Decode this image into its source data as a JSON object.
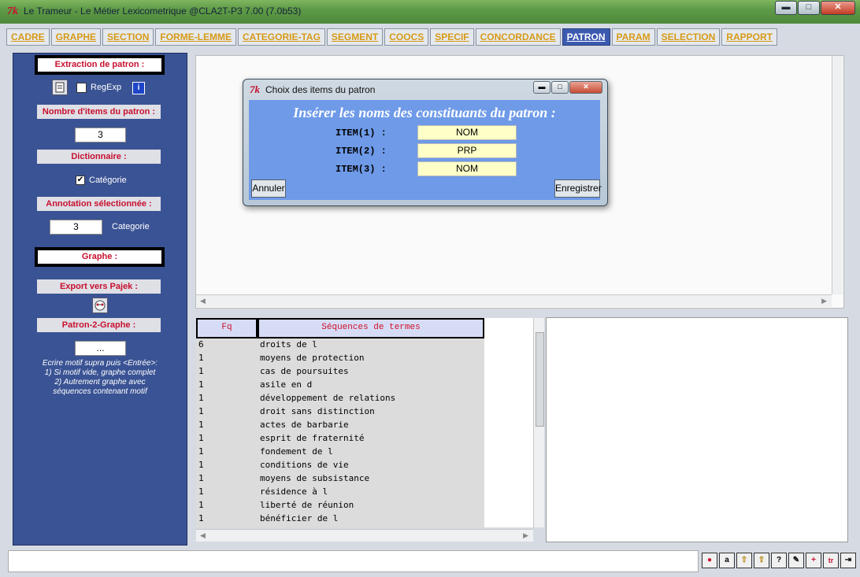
{
  "window": {
    "title": "Le Trameur - Le Métier Lexicometrique @CLA2T-P3 7.00 (7.0b53)",
    "tk_logo": "7k",
    "min": "▬",
    "max": "□",
    "close": "✕"
  },
  "tabs": [
    {
      "label": "CADRE"
    },
    {
      "label": "GRAPHE"
    },
    {
      "label": "SECTION"
    },
    {
      "label": "FORME-LEMME"
    },
    {
      "label": "CATEGORIE-TAG"
    },
    {
      "label": "SEGMENT"
    },
    {
      "label": "COOCS"
    },
    {
      "label": "SPECIF"
    },
    {
      "label": "CONCORDANCE"
    },
    {
      "label": "PATRON",
      "active": true
    },
    {
      "label": "PARAM"
    },
    {
      "label": "SELECTION"
    },
    {
      "label": "RAPPORT"
    }
  ],
  "left": {
    "extraction_label": "Extraction de patron :",
    "regexp_label": "RegExp",
    "regexp_checked": false,
    "info_icon": "i",
    "nb_items_label": "Nombre d'items du patron :",
    "nb_items_value": "3",
    "dictionnaire_label": "Dictionnaire :",
    "categorie_check_label": "Catégorie",
    "categorie_checked": true,
    "annotation_label": "Annotation sélectionnée :",
    "annotation_value": "3",
    "annotation_type": "Categorie",
    "graphe_label": "Graphe :",
    "pajek_label": "Export vers Pajek :",
    "patron2graphe_label": "Patron-2-Graphe :",
    "patron2graphe_value": "...",
    "note_lines": [
      "Ecrire motif supra puis <Entrée>:",
      "1) Si motif vide, graphe complet",
      "2)  Autrement graphe avec",
      "séquences contenant motif"
    ]
  },
  "table": {
    "col_fq": "Fq",
    "col_seq": "Séquences de termes",
    "rows": [
      {
        "fq": "6",
        "seq": "droits de l"
      },
      {
        "fq": "1",
        "seq": "moyens de protection"
      },
      {
        "fq": "1",
        "seq": "cas de poursuites"
      },
      {
        "fq": "1",
        "seq": "asile en d"
      },
      {
        "fq": "1",
        "seq": "développement de relations"
      },
      {
        "fq": "1",
        "seq": "droit sans distinction"
      },
      {
        "fq": "1",
        "seq": "actes de barbarie"
      },
      {
        "fq": "1",
        "seq": "esprit de fraternité"
      },
      {
        "fq": "1",
        "seq": "fondement de l"
      },
      {
        "fq": "1",
        "seq": "conditions de vie"
      },
      {
        "fq": "1",
        "seq": "moyens de subsistance"
      },
      {
        "fq": "1",
        "seq": "résidence à l"
      },
      {
        "fq": "1",
        "seq": "liberté de réunion"
      },
      {
        "fq": "1",
        "seq": "bénéficier de l"
      }
    ]
  },
  "dialog": {
    "title": "Choix des items du patron",
    "heading": "Insérer les noms des constituants du patron :",
    "items": [
      {
        "label": "ITEM(1) :",
        "value": "NOM"
      },
      {
        "label": "ITEM(2) :",
        "value": "PRP"
      },
      {
        "label": "ITEM(3) :",
        "value": "NOM"
      }
    ],
    "cancel_label": "Annuler",
    "save_label": "Enregistrer"
  },
  "toolbar_icons": [
    "stop-icon",
    "text-icon",
    "folder-up-icon",
    "folder-export-icon",
    "help-icon",
    "edit-icon",
    "add-icon",
    "trameur-icon",
    "exit-icon"
  ],
  "toolbar_glyphs": [
    "●",
    "a",
    "⇧",
    "⇪",
    "?",
    "✎",
    "+",
    "tr",
    "⇥"
  ],
  "colors": {
    "accent": "#3b5ab0",
    "tab_text": "#d79a17",
    "label_red": "#c8102e",
    "dialog_body": "#6e9ae8",
    "item_bg": "#ffffc8"
  }
}
